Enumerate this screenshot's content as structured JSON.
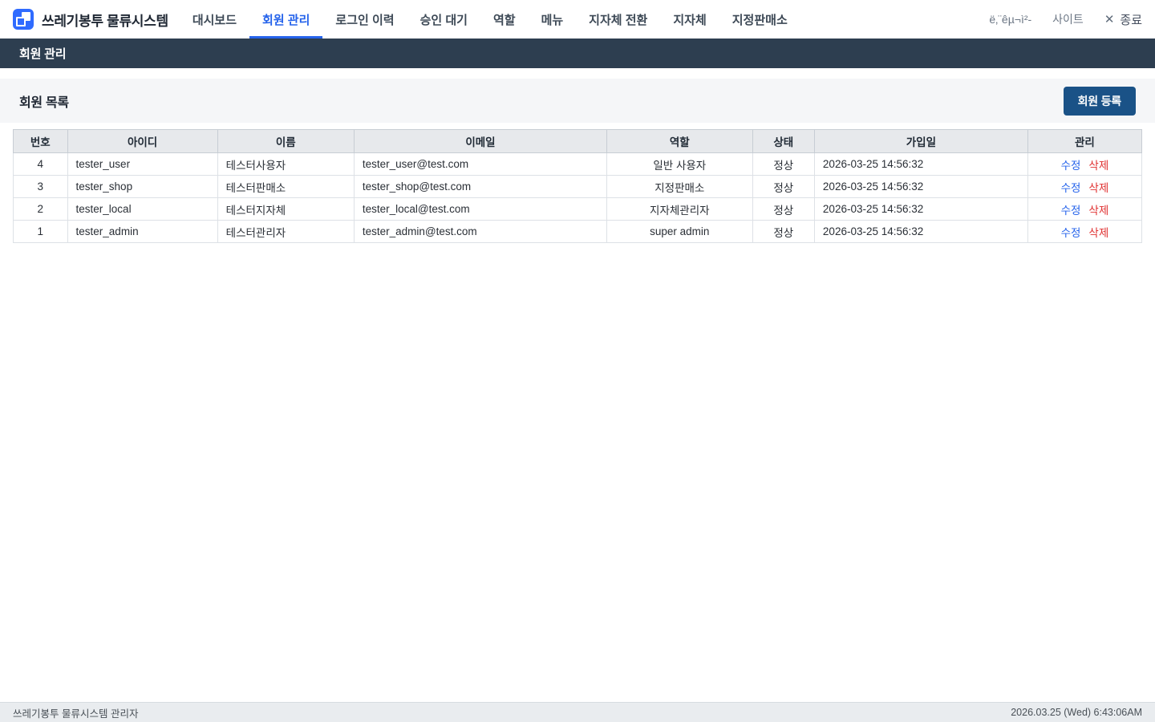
{
  "topbar": {
    "brand": "쓰레기봉투 물류시스템",
    "nav": [
      {
        "label": "대시보드",
        "active": false
      },
      {
        "label": "회원 관리",
        "active": true
      },
      {
        "label": "로그인 이력",
        "active": false
      },
      {
        "label": "승인 대기",
        "active": false
      },
      {
        "label": "역할",
        "active": false
      },
      {
        "label": "메뉴",
        "active": false
      },
      {
        "label": "지자체 전환",
        "active": false
      },
      {
        "label": "지자체",
        "active": false
      },
      {
        "label": "지정판매소",
        "active": false
      }
    ],
    "right": {
      "org": "ë‚¨êµ¬ì²-",
      "site": "사이트",
      "close_icon": "✕",
      "exit": "종료"
    }
  },
  "page_header": {
    "title": "회원 관리"
  },
  "section": {
    "title": "회원 목록",
    "register_button": "회원 등록"
  },
  "table": {
    "columns": [
      "번호",
      "아이디",
      "이름",
      "이메일",
      "역할",
      "상태",
      "가입일",
      "관리"
    ],
    "rows": [
      {
        "no": "4",
        "id": "tester_user",
        "name": "테스터사용자",
        "email": "tester_user@test.com",
        "role": "일반 사용자",
        "status": "정상",
        "joined": "2026-03-25 14:56:32",
        "edit": "수정",
        "delete": "삭제"
      },
      {
        "no": "3",
        "id": "tester_shop",
        "name": "테스터판매소",
        "email": "tester_shop@test.com",
        "role": "지정판매소",
        "status": "정상",
        "joined": "2026-03-25 14:56:32",
        "edit": "수정",
        "delete": "삭제"
      },
      {
        "no": "2",
        "id": "tester_local",
        "name": "테스터지자체",
        "email": "tester_local@test.com",
        "role": "지자체관리자",
        "status": "정상",
        "joined": "2026-03-25 14:56:32",
        "edit": "수정",
        "delete": "삭제"
      },
      {
        "no": "1",
        "id": "tester_admin",
        "name": "테스터관리자",
        "email": "tester_admin@test.com",
        "role": "super admin",
        "status": "정상",
        "joined": "2026-03-25 14:56:32",
        "edit": "수정",
        "delete": "삭제"
      }
    ]
  },
  "footer": {
    "left": "쓰레기봉투 물류시스템 관리자",
    "right": "2026.03.25 (Wed) 6:43:06AM"
  },
  "colors": {
    "accent": "#2563eb",
    "danger": "#e03131",
    "header_bar": "#2d3e50",
    "register_button": "#1a5287",
    "logo": "#2f6bff"
  }
}
